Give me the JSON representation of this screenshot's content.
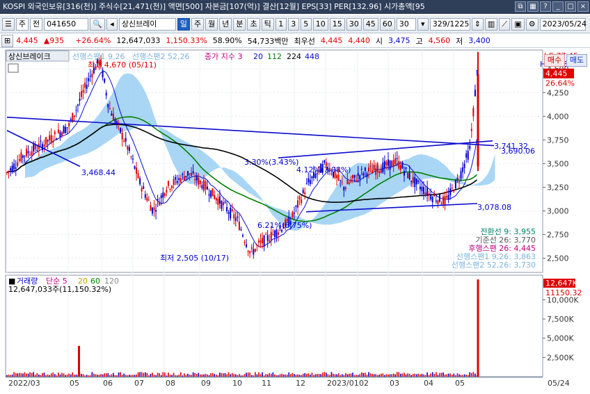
{
  "titlebar": {
    "text": "KOSPI 외국인보유[316(천)] 주식수[21,471(천)] 액면[500] 자본금[107(억)] 결산[12월] EPS[33] PER[132.96] 시가총액[95"
  },
  "toolbar": {
    "market": "주",
    "prev_label": "전",
    "code": "041650",
    "name": "상신브레이",
    "period_buttons": [
      "일",
      "주",
      "월",
      "년",
      "분",
      "초",
      "틱"
    ],
    "interval_buttons": [
      "1",
      "3",
      "5",
      "10",
      "15",
      "30",
      "45",
      "60"
    ],
    "count_value": "30",
    "range": "329/1225",
    "date": "2023/05/24"
  },
  "pricebar": {
    "price": "4,445",
    "change": "935",
    "change_pct": "+26.64%",
    "volume": "12,647,033",
    "volume_pct": "1,150.33%",
    "rate": "58.90%",
    "amount": "54,733백만",
    "best_label": "최우선",
    "best_sell": "4,445",
    "best_buy": "4,440",
    "open_label": "시",
    "open": "3,475",
    "high_label": "고",
    "high": "4,560",
    "low_label": "저",
    "low": "3,400"
  },
  "chart_header": {
    "name": "상신브레이크",
    "legend_span1": "선행스팬1 9,26",
    "legend_span2": "선행스팬2 52,26",
    "legend_close": "종가 지수 3",
    "ma": [
      "20",
      "112",
      "224",
      "448"
    ],
    "lc": "LC:77.45",
    "hc": "HC:-4.82"
  },
  "buttons": {
    "sell": "매수",
    "buy": "매도"
  },
  "annotations": {
    "high": "최고 4,670 (05/11)",
    "low": "최저 2,505 (10/17)",
    "trend1": "3,468.44",
    "trend2": "3,741.32",
    "trend3": "3,690.06",
    "trend4": "3,078.08",
    "pct1": "3.30%(3.43%)",
    "pct2": "6.21%(6.75%)",
    "pct3": "4.12%(7.08%)"
  },
  "ichimoku": {
    "conversion": "전환선 9: 3,955",
    "base": "기준선 26: 3,770",
    "lagging": "후행스팬 26: 4,445",
    "span1": "선행스팬1 9,26: 3,863",
    "span2": "선행스팬2 52,26: 3,730"
  },
  "price_axis": {
    "ticks": [
      "4,500",
      "4,250",
      "4,000",
      "3,750",
      "3,500",
      "3,250",
      "3,000",
      "2,750",
      "2,500"
    ],
    "current": "4,445",
    "current_pct": "26.64%"
  },
  "volume": {
    "header_label": "거래량",
    "legend": [
      "단순 5",
      "20",
      "60",
      "120"
    ],
    "value": "12,647,033주(11,150.32%)",
    "axis_current": "12,647K",
    "axis_pct": "11150.32",
    "ticks": [
      "10,000K",
      "7,500K",
      "5,000K",
      "2,500K"
    ]
  },
  "x_axis": [
    "2022/03",
    "05",
    "06",
    "07",
    "08",
    "09",
    "10",
    "11",
    "12",
    "2023/01",
    "02",
    "03",
    "04",
    "05",
    "05/24"
  ],
  "colors": {
    "up": "#e00000",
    "down": "#0000d0",
    "cloud": "#8cc8f0",
    "ma20": "#0a0ad0",
    "ma112": "#008000",
    "ma224": "#000000"
  }
}
